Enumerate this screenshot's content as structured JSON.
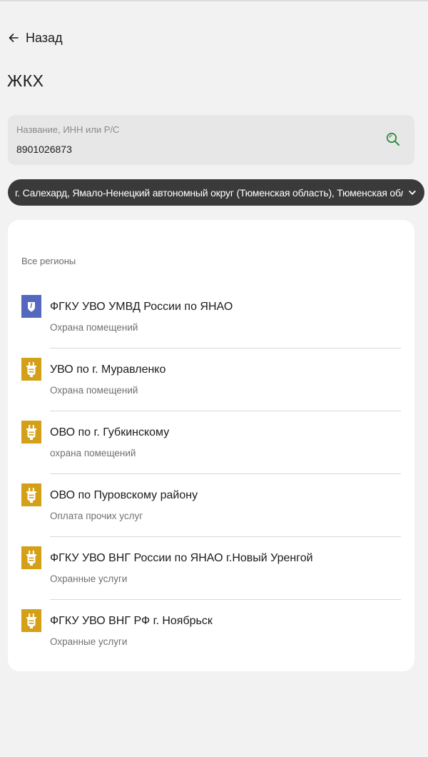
{
  "header": {
    "back_label": "Назад",
    "title": "ЖКХ"
  },
  "search": {
    "placeholder": "Название, ИНН или Р/С",
    "value": "8901026873"
  },
  "region": {
    "label": "г. Салехард, Ямало-Ненецкий автономный округ (Тюменская область), Тюменская область"
  },
  "section": {
    "label": "Все регионы"
  },
  "providers": [
    {
      "title": "ФГКУ УВО УМВД России по ЯНАО",
      "subtitle": "Охрана помещений",
      "icon": "shield-icon",
      "color": "#5468c0"
    },
    {
      "title": "УВО по г. Муравленко",
      "subtitle": "Охрана помещений",
      "icon": "plug-icon",
      "color": "#d4a017"
    },
    {
      "title": "ОВО по г. Губкинскому",
      "subtitle": "охрана помещений",
      "icon": "plug-icon",
      "color": "#d4a017"
    },
    {
      "title": "ОВО по Пуровскому району",
      "subtitle": "Оплата прочих услуг",
      "icon": "plug-icon",
      "color": "#d4a017"
    },
    {
      "title": "ФГКУ УВО ВНГ России по ЯНАО г.Новый Уренгой",
      "subtitle": "Охранные услуги",
      "icon": "plug-icon",
      "color": "#d4a017"
    },
    {
      "title": "ФГКУ УВО ВНГ РФ г. Ноябрьск",
      "subtitle": "Охранные услуги",
      "icon": "plug-icon",
      "color": "#d4a017"
    }
  ],
  "colors": {
    "accent": "#2e8b3a",
    "region_bg": "#3a3a3a",
    "page_bg": "#f2f2f2"
  }
}
